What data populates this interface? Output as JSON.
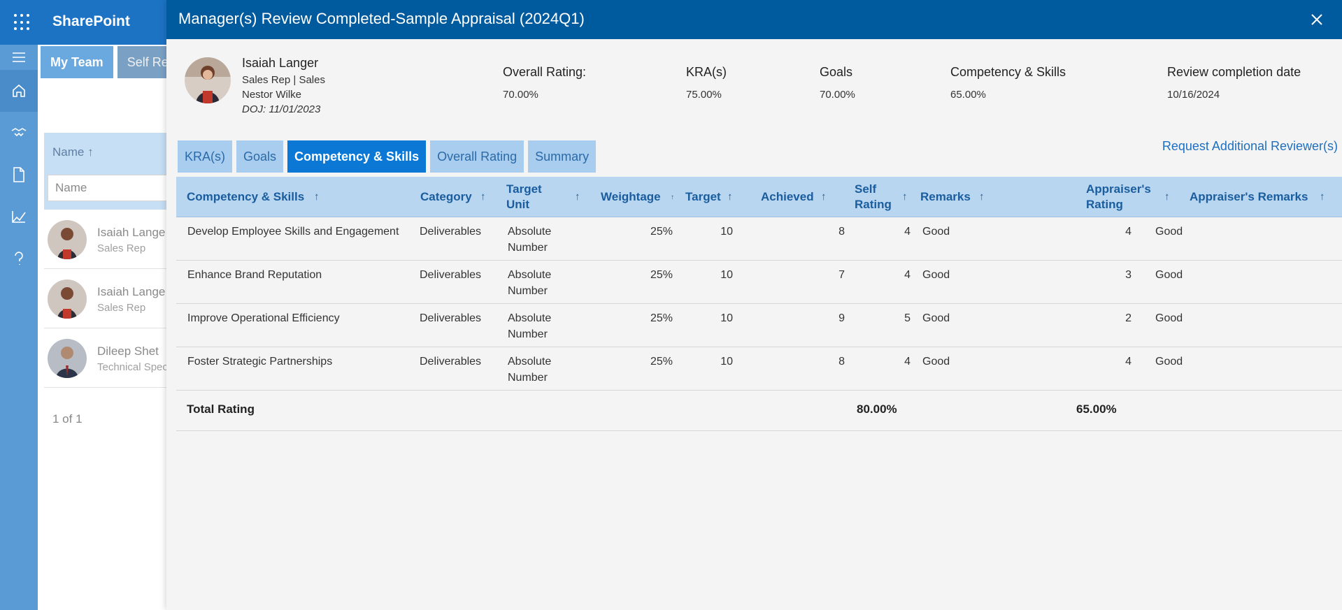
{
  "app": {
    "name": "SharePoint"
  },
  "background": {
    "tabs": [
      "My Team",
      "Self Re"
    ],
    "name_header": "Name ↑",
    "name_placeholder": "Name",
    "rows": [
      {
        "name": "Isaiah Lange",
        "role": "Sales Rep"
      },
      {
        "name": "Isaiah Lange",
        "role": "Sales Rep"
      },
      {
        "name": "Dileep Shet",
        "role": "Technical Spec"
      }
    ],
    "pager": "1 of 1"
  },
  "panel": {
    "title": "Manager(s) Review Completed-Sample Appraisal (2024Q1)",
    "employee": {
      "name": "Isaiah Langer",
      "role": "Sales Rep | Sales",
      "manager": "Nestor Wilke",
      "doj": "DOJ: 11/01/2023"
    },
    "summary": [
      {
        "label": "Overall Rating:",
        "value": "70.00%"
      },
      {
        "label": "KRA(s)",
        "value": "75.00%"
      },
      {
        "label": "Goals",
        "value": "70.00%"
      },
      {
        "label": "Competency & Skills",
        "value": "65.00%"
      },
      {
        "label": "Review completion date",
        "value": "10/16/2024"
      }
    ],
    "tabs": [
      "KRA(s)",
      "Goals",
      "Competency & Skills",
      "Overall Rating",
      "Summary"
    ],
    "active_tab": "Competency & Skills",
    "request_link": "Request Additional Reviewer(s)",
    "columns": {
      "competency": "Competency & Skills",
      "category": "Category",
      "target_unit_1": "Target",
      "target_unit_2": "Unit",
      "weightage": "Weightage",
      "target": "Target",
      "achieved": "Achieved",
      "self_rating_1": "Self",
      "self_rating_2": "Rating",
      "remarks": "Remarks",
      "appraiser_rating_1": "Appraiser's",
      "appraiser_rating_2": "Rating",
      "appraiser_remarks": "Appraiser's Remarks"
    },
    "sort_arrow": "↑",
    "rows": [
      {
        "competency": "Develop Employee Skills and Engagement",
        "category": "Deliverables",
        "unit_1": "Absolute",
        "unit_2": "Number",
        "weightage": "25%",
        "target": "10",
        "achieved": "8",
        "self_rating": "4",
        "remarks": "Good",
        "appraiser_rating": "4",
        "appraiser_remarks": "Good"
      },
      {
        "competency": "Enhance Brand Reputation",
        "category": "Deliverables",
        "unit_1": "Absolute",
        "unit_2": "Number",
        "weightage": "25%",
        "target": "10",
        "achieved": "7",
        "self_rating": "4",
        "remarks": "Good",
        "appraiser_rating": "3",
        "appraiser_remarks": "Good"
      },
      {
        "competency": "Improve Operational Efficiency",
        "category": "Deliverables",
        "unit_1": "Absolute",
        "unit_2": "Number",
        "weightage": "25%",
        "target": "10",
        "achieved": "9",
        "self_rating": "5",
        "remarks": "Good",
        "appraiser_rating": "2",
        "appraiser_remarks": "Good"
      },
      {
        "competency": "Foster Strategic Partnerships",
        "category": "Deliverables",
        "unit_1": "Absolute",
        "unit_2": "Number",
        "weightage": "25%",
        "target": "10",
        "achieved": "8",
        "self_rating": "4",
        "remarks": "Good",
        "appraiser_rating": "4",
        "appraiser_remarks": "Good"
      }
    ],
    "total": {
      "label": "Total Rating",
      "self": "80.00%",
      "appraiser": "65.00%"
    }
  }
}
